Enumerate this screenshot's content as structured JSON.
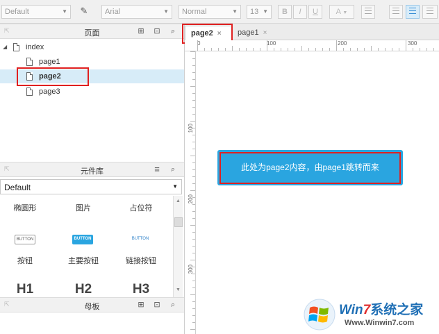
{
  "toolbar": {
    "style_select": "Default",
    "font_select": "Arial",
    "weight_select": "Normal",
    "size_select": "13",
    "bold": "B",
    "italic": "I",
    "underline": "U",
    "font_color": "A"
  },
  "pages_panel": {
    "title": "页面",
    "tree": {
      "root": "index",
      "children": [
        "page1",
        "page2",
        "page3"
      ],
      "selected": "page2"
    }
  },
  "library_panel": {
    "title": "元件库",
    "library_select": "Default",
    "items_row1": [
      "椭圆形",
      "图片",
      "占位符"
    ],
    "button_thumbs": [
      "BUTTON",
      "BUTTON",
      "BUTTON"
    ],
    "items_row2": [
      "按钮",
      "主要按钮",
      "链接按钮"
    ],
    "headings": [
      "H1",
      "H2",
      "H3"
    ]
  },
  "masters_panel": {
    "title": "母板"
  },
  "tabs": [
    {
      "label": "page2",
      "active": true,
      "close": "×"
    },
    {
      "label": "page1",
      "active": false,
      "close": "×"
    }
  ],
  "ruler": {
    "h_labels": [
      "0",
      "100",
      "200",
      "300"
    ],
    "v_labels": [
      "100",
      "200",
      "300"
    ]
  },
  "canvas": {
    "content_text": "此处为page2内容，由page1跳转而来",
    "content_color": "#2aa5e0"
  },
  "watermark": {
    "brand_prefix": "Win",
    "brand_digit": "7",
    "brand_cn": "系统之家",
    "url": "Www.Winwin7.com"
  },
  "colors": {
    "highlight": "#e02020",
    "selected_row": "#d7ecf8",
    "accent": "#3a8fd6"
  }
}
